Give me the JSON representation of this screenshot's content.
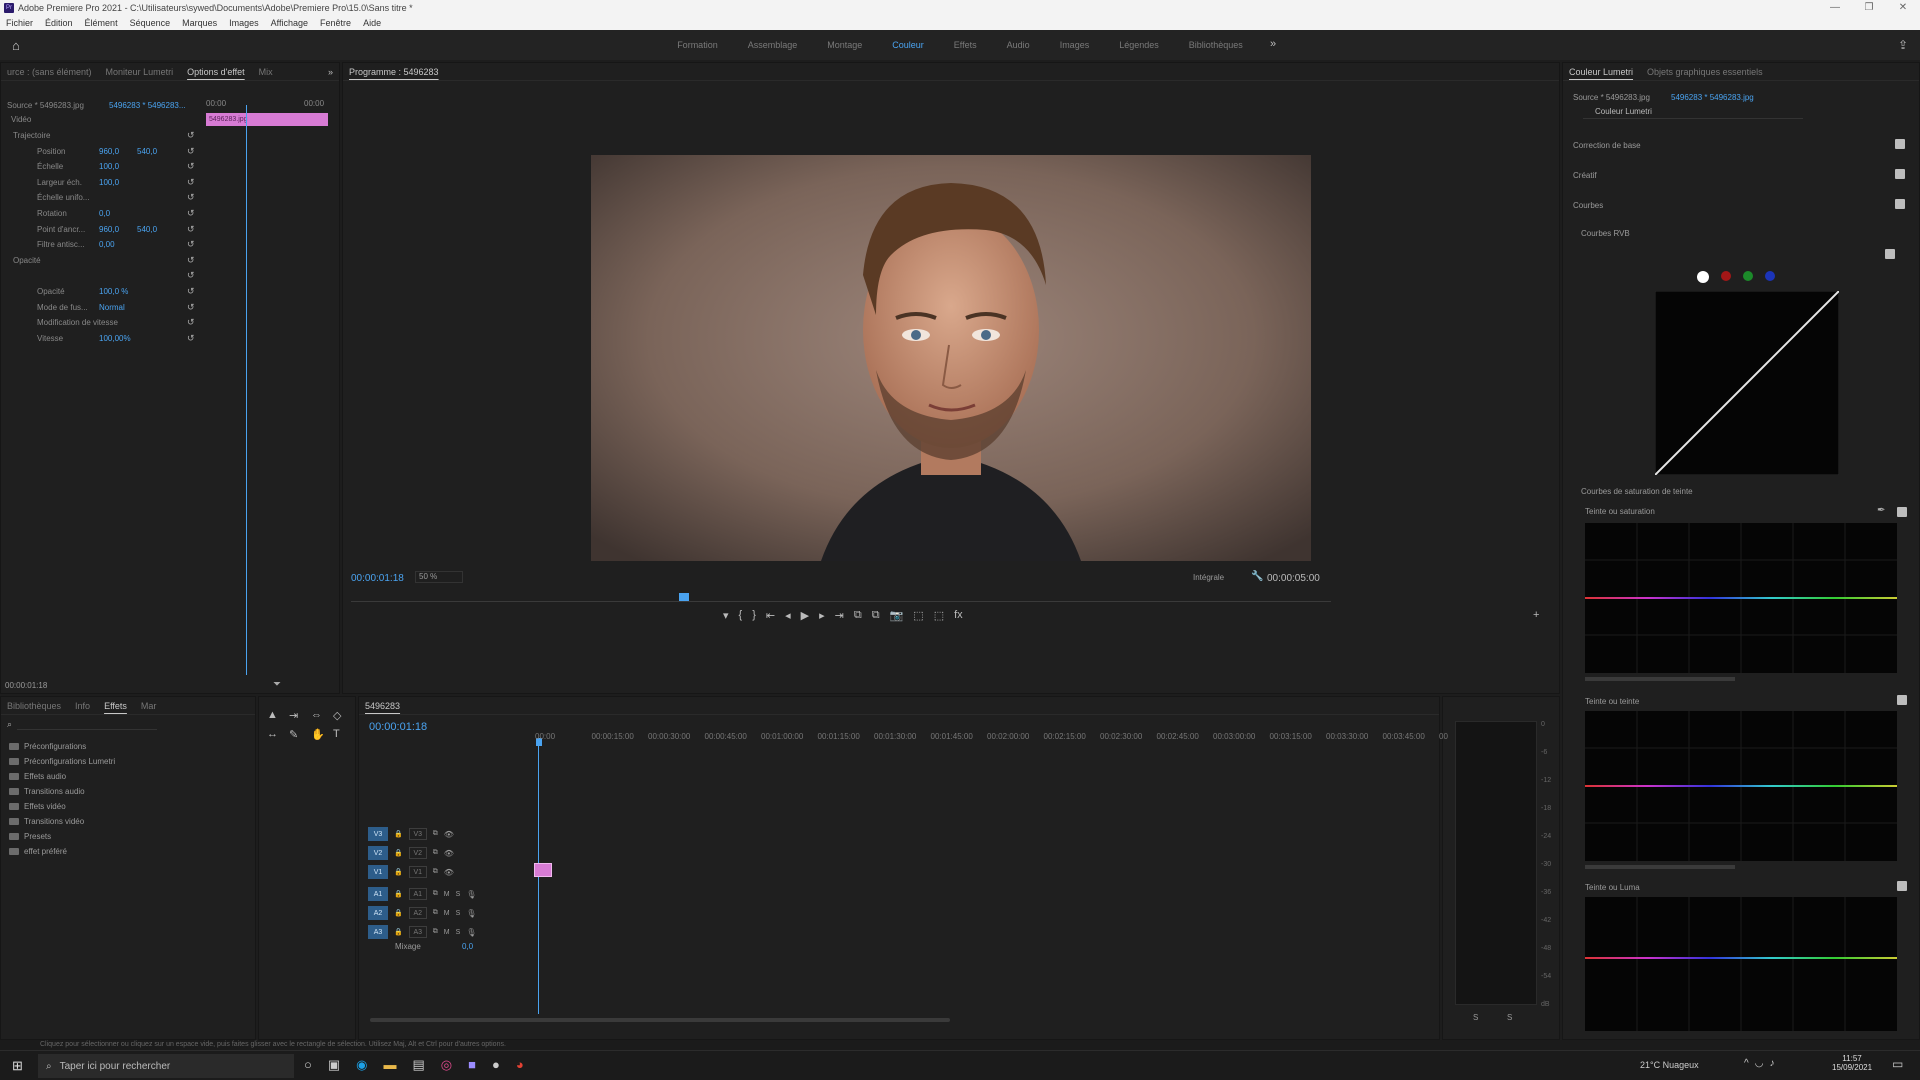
{
  "window": {
    "title": "Adobe Premiere Pro 2021 - C:\\Utilisateurs\\sywed\\Documents\\Adobe\\Premiere Pro\\15.0\\Sans titre *",
    "controls": [
      "—",
      "❐",
      "✕"
    ]
  },
  "menu": [
    "Fichier",
    "Édition",
    "Élément",
    "Séquence",
    "Marques",
    "Images",
    "Affichage",
    "Fenêtre",
    "Aide"
  ],
  "workspaces": {
    "tabs": [
      "Formation",
      "Assemblage",
      "Montage",
      "Couleur",
      "Effets",
      "Audio",
      "Images",
      "Légendes",
      "Bibliothèques"
    ],
    "active": "Couleur",
    "more": "»"
  },
  "effect_controls": {
    "tabs": [
      "urce : (sans élément)",
      "Moniteur Lumetri",
      "Options d'effet",
      "Mix"
    ],
    "active_tab": "Options d'effet",
    "source_label": "Source * 5496283.jpg",
    "clip_label": "5496283 * 5496283...",
    "timecode_start": "00:00",
    "timecode_end": "00:00",
    "clip_name": "5496283.jpg",
    "section_video": "Vidéo",
    "rows": [
      {
        "label": "Trajectoire",
        "v1": "",
        "v2": "",
        "fx": true
      },
      {
        "label": "Position",
        "v1": "960,0",
        "v2": "540,0"
      },
      {
        "label": "Échelle",
        "v1": "100,0",
        "v2": ""
      },
      {
        "label": "Largeur éch.",
        "v1": "100,0",
        "v2": ""
      },
      {
        "label": "Échelle unifo...",
        "v1": "",
        "v2": ""
      },
      {
        "label": "Rotation",
        "v1": "0,0",
        "v2": ""
      },
      {
        "label": "Point d'ancr...",
        "v1": "960,0",
        "v2": "540,0"
      },
      {
        "label": "Filtre antisc...",
        "v1": "0,00",
        "v2": ""
      },
      {
        "label": "Opacité",
        "v1": "",
        "v2": "",
        "fx": true
      },
      {
        "label": "",
        "v1": "",
        "v2": ""
      },
      {
        "label": "Opacité",
        "v1": "100,0 %",
        "v2": ""
      },
      {
        "label": "Mode de fus...",
        "v1": "Normal",
        "v2": ""
      },
      {
        "label": "Modification de vitesse",
        "v1": "",
        "v2": ""
      },
      {
        "label": "Vitesse",
        "v1": "100,00%",
        "v2": ""
      }
    ],
    "footer_timecode": "00:00:01:18"
  },
  "program_monitor": {
    "title": "Programme : 5496283",
    "timecode": "00:00:01:18",
    "zoom": "50 %",
    "quality": "Intégrale",
    "duration": "00:00:05:00",
    "controls": [
      "▾",
      "{",
      "}",
      "⇤",
      "◂",
      "▶",
      "▸",
      "⇥",
      "⧉",
      "⧉",
      "📷",
      "⬚",
      "⬚",
      "fx"
    ],
    "add": "+"
  },
  "project_panel": {
    "tabs": [
      "Bibliothèques",
      "Info",
      "Effets",
      "Mar"
    ],
    "active_tab": "Effets",
    "folders": [
      "Préconfigurations",
      "Préconfigurations Lumetri",
      "Effets audio",
      "Transitions audio",
      "Effets vidéo",
      "Transitions vidéo",
      "Presets",
      "effet préféré"
    ]
  },
  "timeline": {
    "sequence": "5496283",
    "timecode": "00:00:01:18",
    "ruler": [
      "00:00",
      "00:00:15:00",
      "00:00:30:00",
      "00:00:45:00",
      "00:01:00:00",
      "00:01:15:00",
      "00:01:30:00",
      "00:01:45:00",
      "00:02:00:00",
      "00:02:15:00",
      "00:02:30:00",
      "00:02:45:00",
      "00:03:00:00",
      "00:03:15:00",
      "00:03:30:00",
      "00:03:45:00",
      "00"
    ],
    "tracks": [
      {
        "src": "V3",
        "name": "V3",
        "kind": "video"
      },
      {
        "src": "V2",
        "name": "V2",
        "kind": "video"
      },
      {
        "src": "V1",
        "name": "V1",
        "kind": "video"
      },
      {
        "src": "A1",
        "name": "A1",
        "kind": "audio"
      },
      {
        "src": "A2",
        "name": "A2",
        "kind": "audio"
      },
      {
        "src": "A3",
        "name": "A3",
        "kind": "audio"
      }
    ],
    "mix_label": "Mixage",
    "mix_value": "0,0"
  },
  "audio_meter": {
    "scale": [
      "0",
      "-6",
      "-12",
      "-18",
      "-24",
      "-30",
      "-36",
      "-42",
      "-48",
      "-54",
      "dB"
    ],
    "footer": [
      "S",
      "S"
    ]
  },
  "lumetri": {
    "tabs": [
      "Couleur Lumetri",
      "Objets graphiques essentiels"
    ],
    "source": "Source * 5496283.jpg",
    "clip": "5496283 * 5496283.jpg",
    "effect": "Couleur Lumetri",
    "sections": [
      "Correction de base",
      "Créatif",
      "Courbes"
    ],
    "rgb_curves": "Courbes RVB",
    "hue_sat_curves": "Courbes de saturation de teinte",
    "curves": [
      "Teinte ou saturation",
      "Teinte ou teinte",
      "Teinte ou Luma"
    ]
  },
  "status_bar": {
    "text": "Cliquez pour sélectionner ou cliquez sur un espace vide, puis faites glisser avec le rectangle de sélection. Utilisez Maj, Alt et Ctrl pour d'autres options."
  },
  "taskbar": {
    "search_placeholder": "Taper ici pour rechercher",
    "weather": "21°C  Nuageux",
    "time": "11:57",
    "date": "15/09/2021"
  },
  "colors": {
    "accent": "#4aa3f0",
    "clip_pink": "#d77bd4",
    "panel_bg": "#1f1f1f"
  }
}
